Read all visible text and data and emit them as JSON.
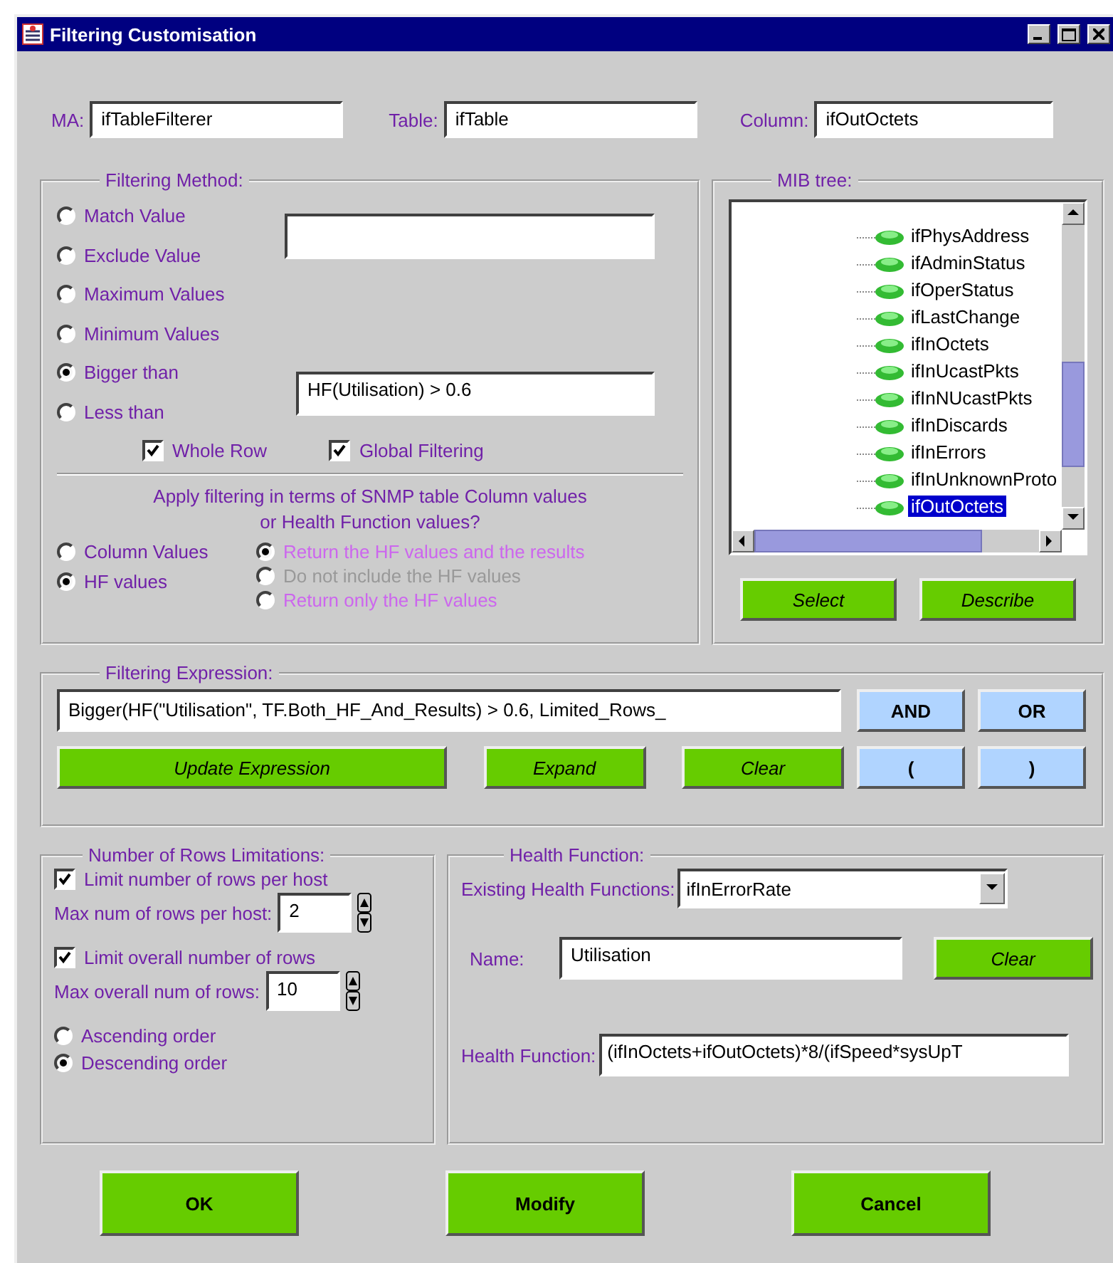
{
  "window": {
    "title": "Filtering Customisation"
  },
  "header_fields": [
    {
      "label": "MA:",
      "value": "ifTableFilterer"
    },
    {
      "label": "Table:",
      "value": "ifTable"
    },
    {
      "label": "Column:",
      "value": "ifOutOctets"
    }
  ],
  "filtering_method": {
    "title": "Filtering Method:",
    "options": [
      {
        "label": "Match Value",
        "selected": false
      },
      {
        "label": "Exclude Value",
        "selected": false
      },
      {
        "label": "Maximum Values",
        "selected": false
      },
      {
        "label": "Minimum Values",
        "selected": false
      },
      {
        "label": "Bigger than",
        "selected": true
      },
      {
        "label": "Less than",
        "selected": false
      }
    ],
    "threshold_value": "HF(Utilisation) > 0.6",
    "checkboxes": [
      {
        "label": "Whole Row",
        "checked": true
      },
      {
        "label": "Global Filtering",
        "checked": true
      }
    ],
    "question": [
      "Apply filtering in terms of SNMP table Column values",
      "or Health Function values?"
    ],
    "value_types": [
      {
        "label": "Column Values",
        "selected": false
      },
      {
        "label": "HF values",
        "selected": true
      }
    ],
    "hf_options": [
      {
        "label": "Return the HF values and the results",
        "selected": true,
        "disabled": false
      },
      {
        "label": "Do not include the HF values",
        "selected": false,
        "disabled": true
      },
      {
        "label": "Return only the HF values",
        "selected": false,
        "disabled": false
      }
    ]
  },
  "mib_tree": {
    "title": "MIB tree:",
    "items": [
      {
        "label": "ifPhysAddress",
        "selected": false
      },
      {
        "label": "ifAdminStatus",
        "selected": false
      },
      {
        "label": "ifOperStatus",
        "selected": false
      },
      {
        "label": "ifLastChange",
        "selected": false
      },
      {
        "label": "ifInOctets",
        "selected": false
      },
      {
        "label": "ifInUcastPkts",
        "selected": false
      },
      {
        "label": "ifInNUcastPkts",
        "selected": false
      },
      {
        "label": "ifInDiscards",
        "selected": false
      },
      {
        "label": "ifInErrors",
        "selected": false
      },
      {
        "label": "ifInUnknownProto",
        "selected": false
      },
      {
        "label": "ifOutOctets",
        "selected": true
      }
    ],
    "buttons": [
      "Select",
      "Describe"
    ]
  },
  "filtering_expression": {
    "title": "Filtering Expression:",
    "value": "Bigger(HF(\"Utilisation\", TF.Both_HF_And_Results) > 0.6, Limited_Rows_",
    "buttons": [
      "Update Expression",
      "Expand",
      "Clear"
    ],
    "operators": [
      "AND",
      "OR",
      "(",
      ")"
    ]
  },
  "row_limits": {
    "title": "Number of Rows Limitations:",
    "limits": [
      {
        "label": "Limit number of rows per host",
        "checked": true,
        "field_label": "Max num of rows per host:",
        "value": "2"
      },
      {
        "label": "Limit overall number of rows",
        "checked": true,
        "field_label": "Max overall num of rows:",
        "value": "10"
      }
    ],
    "order": [
      {
        "label": "Ascending order",
        "selected": false
      },
      {
        "label": "Descending order",
        "selected": true
      }
    ]
  },
  "health_function": {
    "title": "Health Function:",
    "existing_label": "Existing Health Functions:",
    "existing_value": "ifInErrorRate",
    "name_label": "Name:",
    "name_value": "Utilisation",
    "clear_button": "Clear",
    "function_label": "Health Function:",
    "function_value": "(ifInOctets+ifOutOctets)*8/(ifSpeed*sysUpT"
  },
  "buttons": [
    "OK",
    "Modify",
    "Cancel"
  ]
}
